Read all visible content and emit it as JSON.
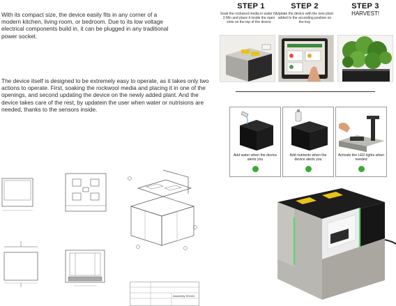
{
  "intro": {
    "paragraph1": "With its compact size, the device easily fits in any corner of a modern kitchen, living room, or bedroom. Due to its low voltage electrical components build in, it can be plugged in any traditional power socket.",
    "paragraph2": "The device itself is designed to be extremely easy to operate, as it takes only two actions to operate. First,  soaking the rockwool media and placing it in one of the openings, and second updating the device on the newly added plant. And the device takes care of the rest, by updatein the user when water or nutrisions are needed, thanks to the sensors inside."
  },
  "steps": [
    {
      "title": "STEP 1",
      "description": "Soak the rockwool media in water for 3 Min and place it inside the open slots on the top of the device"
    },
    {
      "title": "STEP 2",
      "description": "Update the device with the new plant added to the according position on the tray"
    },
    {
      "title": "STEP 3",
      "description": "HARVEST!"
    }
  ],
  "alerts": [
    {
      "label": "Add water when the device alerts you",
      "status_color": "#3aaa35"
    },
    {
      "label": "Add nutrients when the device alerts you",
      "status_color": "#3aaa35"
    },
    {
      "label": "Activate the LED lights when needed",
      "status_color": "#3aaa35"
    }
  ],
  "drawings": {
    "title_block_label": "Assembly SOA04"
  },
  "colors": {
    "concrete": "#b9b7b1",
    "device_black": "#1d1d1d",
    "accent_yellow": "#e8c21a",
    "status_green": "#3aaa35",
    "led_green": "#5cd36b"
  }
}
